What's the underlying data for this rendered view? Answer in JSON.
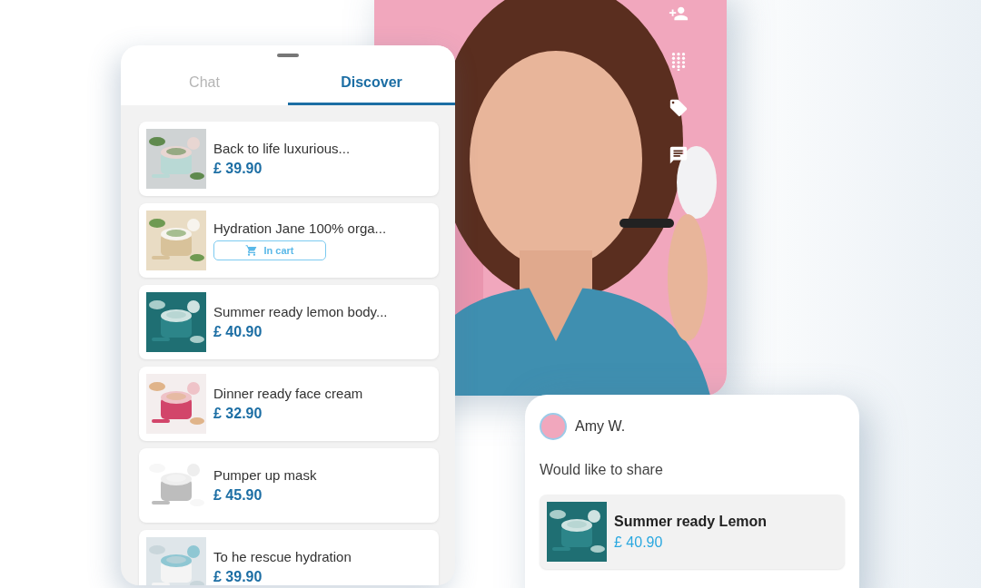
{
  "video_call": {
    "actions": [
      {
        "kind": "add_person"
      },
      {
        "kind": "dialpad"
      },
      {
        "kind": "tag"
      },
      {
        "kind": "chat"
      }
    ]
  },
  "panel": {
    "tabs": [
      {
        "label": "Chat",
        "selected": false
      },
      {
        "label": "Discover",
        "selected": true
      }
    ],
    "products": [
      {
        "name": "Back to life luxurious...",
        "kind": "price",
        "price": "£ 39.90"
      },
      {
        "name": "Hydration Jane 100% orga...",
        "kind": "cart",
        "cart_label": "In cart"
      },
      {
        "name": "Summer ready lemon body...",
        "kind": "price",
        "price": "£ 40.90"
      },
      {
        "name": "Dinner ready face cream",
        "kind": "price",
        "price": "£ 32.90"
      },
      {
        "name": "Pumper up mask",
        "kind": "price",
        "price": "£ 45.90"
      },
      {
        "name": "To he rescue hydration",
        "kind": "price",
        "price": "£ 39.90"
      }
    ]
  },
  "share_card": {
    "sender": "Amy W.",
    "message": "Would like to share",
    "product": {
      "name": "Summer ready Lemon",
      "price": "£ 40.90"
    }
  }
}
